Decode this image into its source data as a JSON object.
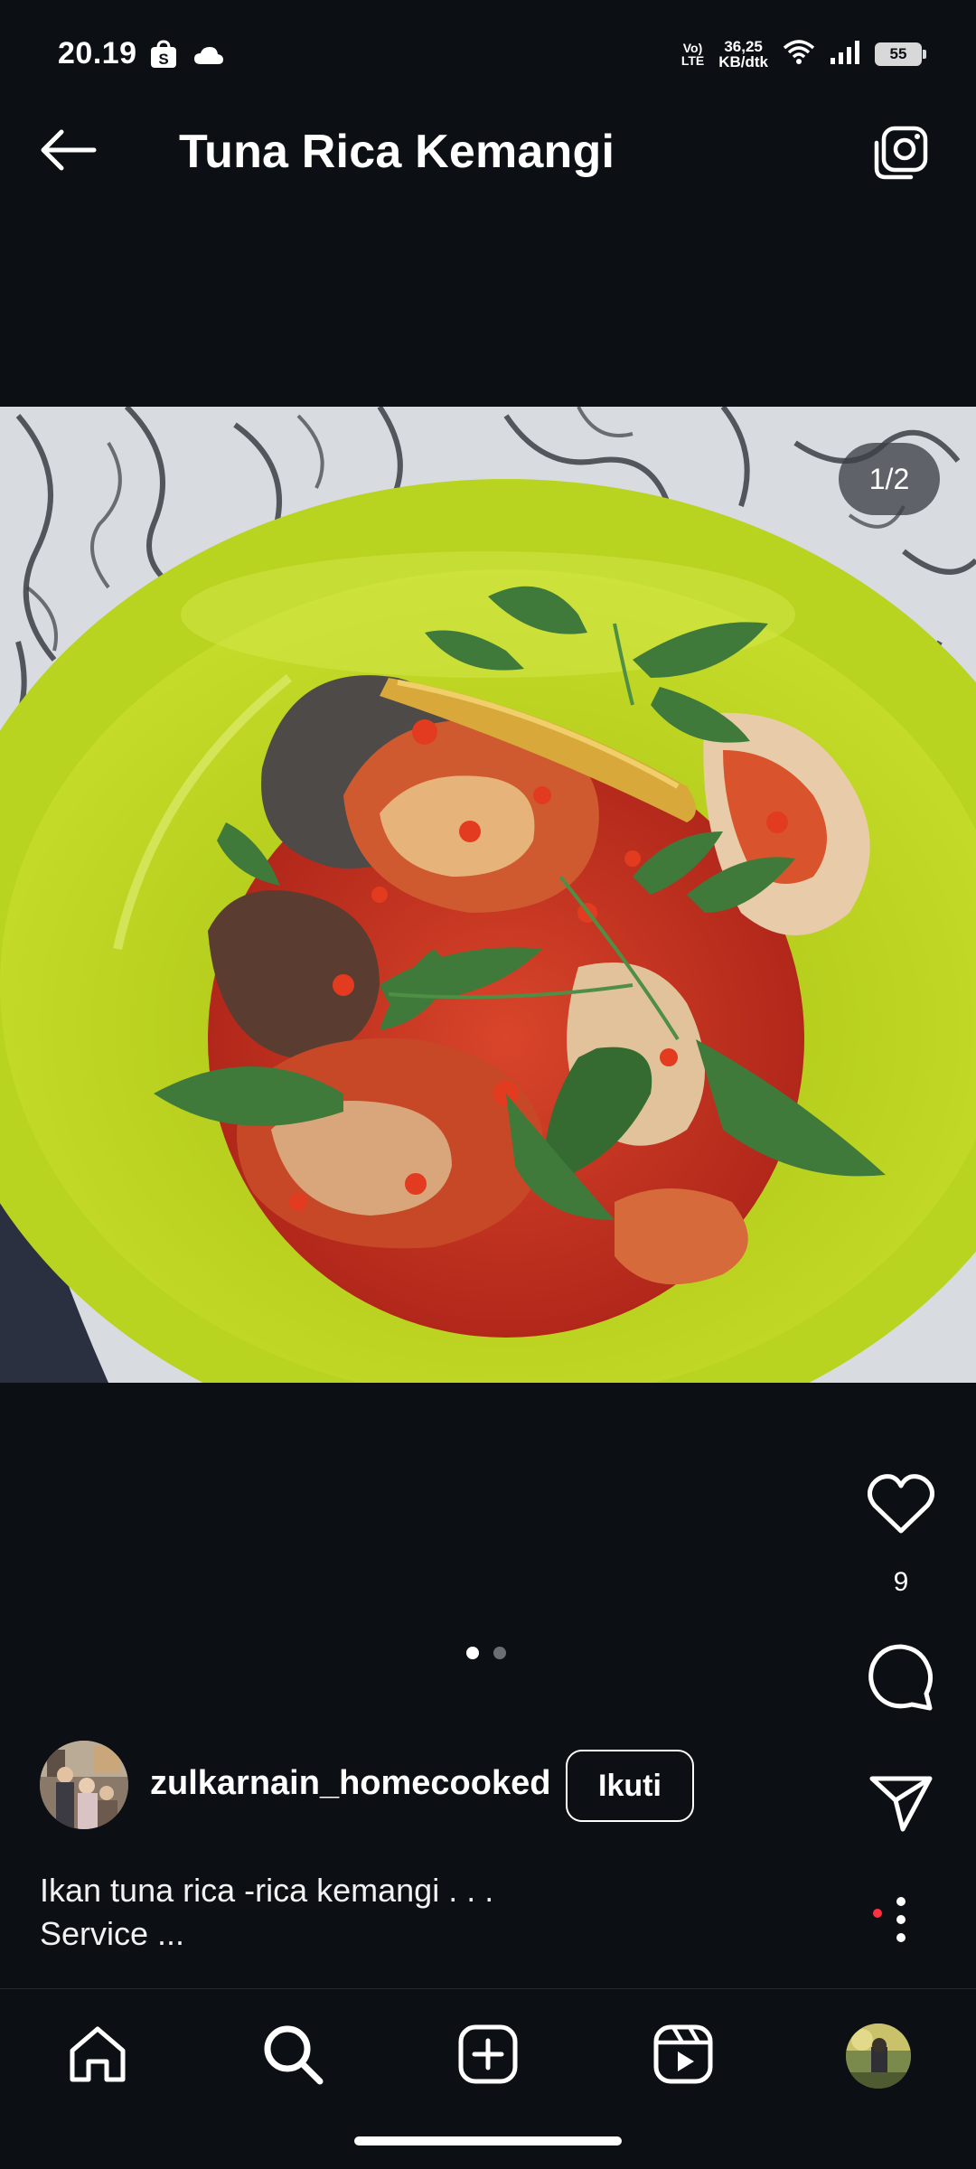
{
  "status_bar": {
    "time": "20.19",
    "net_speed_value": "36,25",
    "net_speed_unit": "KB/dtk",
    "volte_top": "Vo)",
    "volte_bottom": "LTE",
    "battery": "55",
    "icons": [
      "shopee-icon",
      "cloud-icon",
      "wifi-icon",
      "signal-icon",
      "battery-icon"
    ]
  },
  "header": {
    "title": "Tuna Rica Kemangi",
    "icons": [
      "back-arrow-icon",
      "camera-icon"
    ]
  },
  "media": {
    "counter": "1/2",
    "current_index": 1,
    "total": 2,
    "colors": {
      "bowl": "#b7d31e",
      "sauce": "#c9301e",
      "leaves": "#3f7a3a"
    }
  },
  "actions": {
    "like_count": "9",
    "icons": [
      "heart-icon",
      "comment-icon",
      "share-icon",
      "more-icon"
    ]
  },
  "author": {
    "username": "zulkarnain_homecooked",
    "follow_label": "Ikuti"
  },
  "caption": {
    "line1": "Ikan tuna rica -rica kemangi . . .",
    "line2": "Service ..."
  },
  "bottom_nav": {
    "items": [
      "home-icon",
      "search-icon",
      "create-icon",
      "reels-icon",
      "profile-avatar"
    ],
    "notification_dot_color": "#ff3040"
  }
}
